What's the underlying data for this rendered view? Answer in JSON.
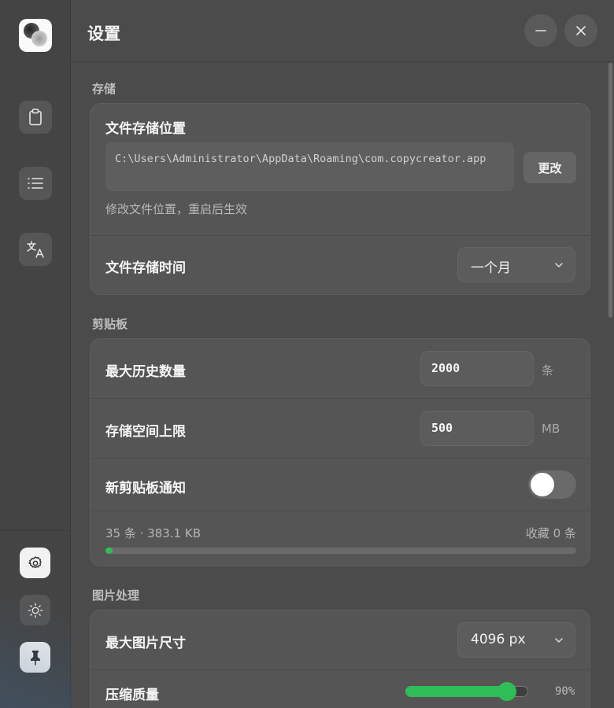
{
  "app": {
    "title": "设置"
  },
  "sidebar": {
    "items": [
      {
        "name": "clipboard",
        "icon": "clipboard-icon"
      },
      {
        "name": "list",
        "icon": "list-icon"
      },
      {
        "name": "translate",
        "icon": "translate-icon"
      }
    ],
    "bottom": [
      {
        "name": "settings",
        "icon": "gear-icon",
        "active": true
      },
      {
        "name": "theme",
        "icon": "sun-icon"
      },
      {
        "name": "pin",
        "icon": "pin-icon",
        "active": true
      }
    ]
  },
  "storage": {
    "section_label": "存储",
    "location_label": "文件存储位置",
    "path": "C:\\Users\\Administrator\\AppData\\Roaming\\com.copycreator.app",
    "change_button": "更改",
    "hint": "修改文件位置，重启后生效",
    "retention_label": "文件存储时间",
    "retention_value": "一个月"
  },
  "clipboard": {
    "section_label": "剪贴板",
    "max_history_label": "最大历史数量",
    "max_history_value": "2000",
    "max_history_unit": "条",
    "storage_limit_label": "存储空间上限",
    "storage_limit_value": "500",
    "storage_limit_unit": "MB",
    "notify_label": "新剪贴板通知",
    "notify_enabled": false,
    "stats_left": "35 条 · 383.1 KB",
    "stats_right": "收藏 0 条",
    "usage_fraction": 0.015
  },
  "image": {
    "section_label": "图片处理",
    "max_size_label": "最大图片尺寸",
    "max_size_value": "4096 px",
    "quality_label": "压缩质量",
    "quality_value": "90%",
    "quality_fraction": 0.9
  },
  "colors": {
    "accent": "#2fbd58",
    "background": "#4b4b4b",
    "card": "#555555"
  }
}
